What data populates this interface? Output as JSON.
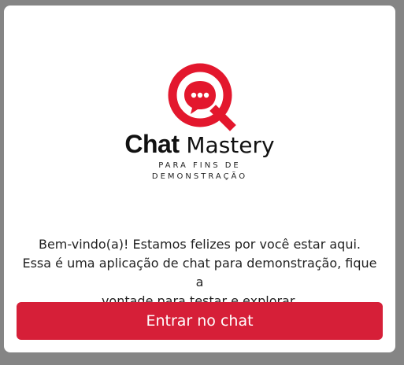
{
  "brand": {
    "name_bold": "Chat",
    "name_light": "Mastery",
    "tagline_line1": "PARA FINS DE",
    "tagline_line2": "DEMONSTRAÇÃO",
    "icon": "chat-search-logo-icon",
    "accent_color": "#E3172D"
  },
  "welcome": {
    "line1": "Bem-vindo(a)! Estamos felizes por você estar aqui.",
    "line2": "Essa é uma aplicação de chat para demonstração, fique a",
    "line3": "vontade para testar e explorar."
  },
  "actions": {
    "enter_label": "Entrar no chat",
    "button_color": "#D61F38"
  }
}
